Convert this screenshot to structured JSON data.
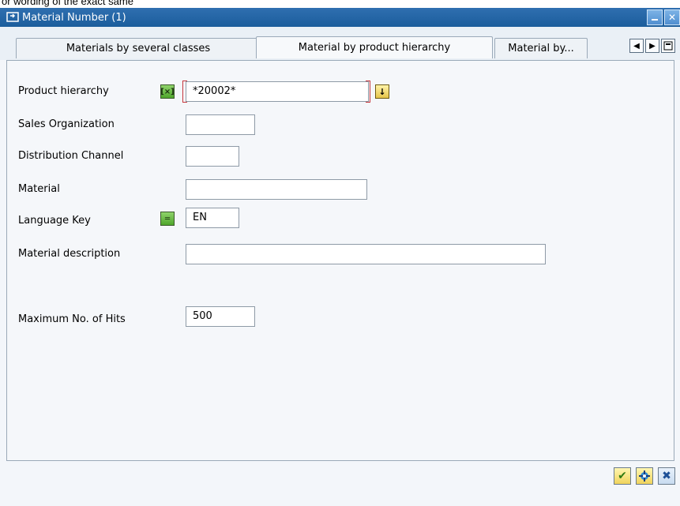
{
  "top_text": "or wording of the exact same",
  "window": {
    "title": "Material Number (1)",
    "title_icon": "window-icon",
    "minimize_icon": "minimize-icon",
    "close_icon": "close-icon"
  },
  "tabs": [
    {
      "label": "Materials by several classes",
      "active": false
    },
    {
      "label": "Material by product hierarchy",
      "active": true
    },
    {
      "label": "Material by...",
      "active": false
    }
  ],
  "tab_controls": {
    "prev_icon": "chevron-left-icon",
    "next_icon": "chevron-right-icon",
    "list_icon": "list-icon"
  },
  "form": {
    "product_hierarchy": {
      "label": "Product hierarchy",
      "value": "*20002*"
    },
    "sales_org": {
      "label": "Sales Organization",
      "value": ""
    },
    "dist_channel": {
      "label": "Distribution Channel",
      "value": ""
    },
    "material": {
      "label": "Material",
      "value": ""
    },
    "language_key": {
      "label": "Language Key",
      "value": "EN"
    },
    "material_description": {
      "label": "Material description",
      "value": ""
    },
    "max_hits": {
      "label": "Maximum No. of Hits",
      "value": "500"
    }
  },
  "footer": {
    "ok_icon": "checkmark-icon",
    "multi_select_icon": "multiple-selection-icon",
    "cancel_icon": "cancel-icon"
  }
}
